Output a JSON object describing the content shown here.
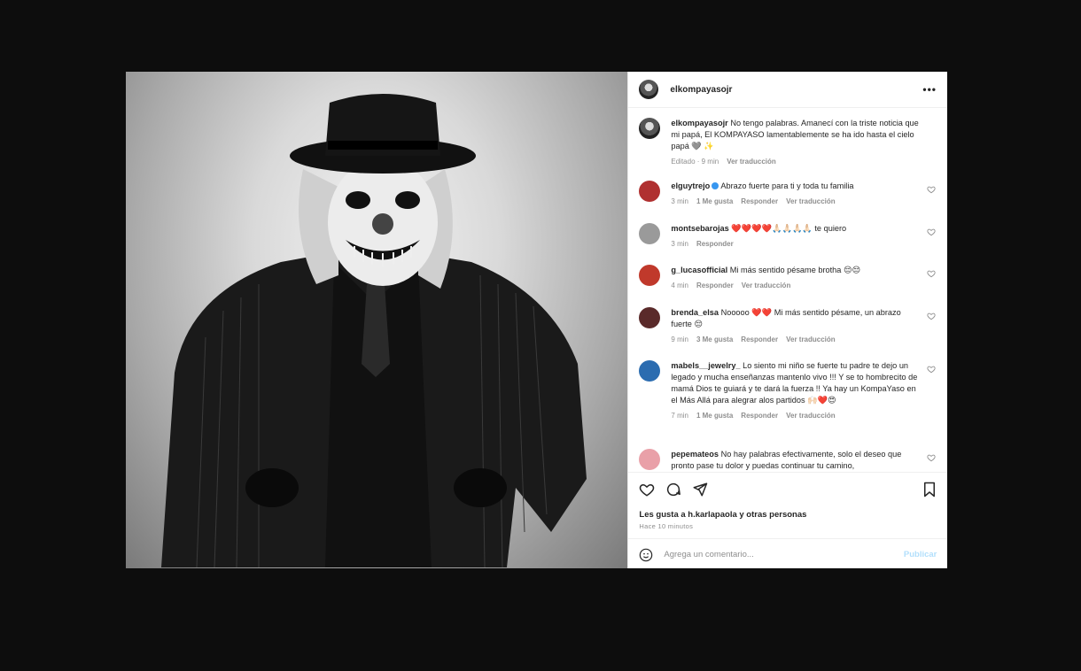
{
  "header": {
    "username": "elkompayasojr",
    "more_label": "•••"
  },
  "caption": {
    "username": "elkompayasojr",
    "text": "No tengo palabras. Amanecí con la triste noticia que mi papá, El KOMPAYASO lamentablemente se ha ido hasta el cielo papá 🩶 ✨",
    "edited": "Editado · 9 min",
    "translate": "Ver traducción"
  },
  "comments": [
    {
      "username": "elguytrejo",
      "verified": true,
      "text": "Abrazo fuerte para ti y toda tu familia",
      "time": "3 min",
      "likes": "1 Me gusta",
      "reply": "Responder",
      "translate": "Ver traducción",
      "avatar_color": "#b03030"
    },
    {
      "username": "montsebarojas",
      "text": "❤️❤️❤️❤️🙏🏻🙏🏻🙏🏻🙏🏻 te quiero",
      "time": "3 min",
      "reply": "Responder",
      "avatar_color": "#9a9a9a"
    },
    {
      "username": "g_lucasofficial",
      "text": "Mi más sentido pésame brotha 😔😔",
      "time": "4 min",
      "reply": "Responder",
      "translate": "Ver traducción",
      "avatar_color": "#c0392b"
    },
    {
      "username": "brenda_elsa",
      "text": "Nooooo ❤️❤️ Mi más sentido pésame, un abrazo fuerte 😔",
      "time": "9 min",
      "likes": "3 Me gusta",
      "reply": "Responder",
      "translate": "Ver traducción",
      "avatar_color": "#5a2a2a"
    },
    {
      "username": "mabels__jewelry_",
      "text": "Lo siento mi niño se fuerte tu padre te dejo un legado y mucha enseñanzas mantenlo vivo !!! Y se to hombrecito de mamá Dios te guiará y te dará la fuerza !! Ya hay un KompaYaso en el Más Allá para alegrar alos partidos 🙌🏻❤️😍",
      "time": "7 min",
      "likes": "1 Me gusta",
      "reply": "Responder",
      "translate": "Ver traducción",
      "avatar_color": "#2b6cb0"
    },
    {
      "username": "pepemateos",
      "text": "No hay palabras efectivamente, solo el deseo que pronto pase tu dolor y puedas continuar tu camino,",
      "avatar_color": "#e9a0a8"
    }
  ],
  "footer": {
    "likes_text": "Les gusta a h.karlapaola y otras personas",
    "time": "Hace 10 minutos",
    "add_comment_placeholder": "Agrega un comentario...",
    "publish": "Publicar"
  }
}
